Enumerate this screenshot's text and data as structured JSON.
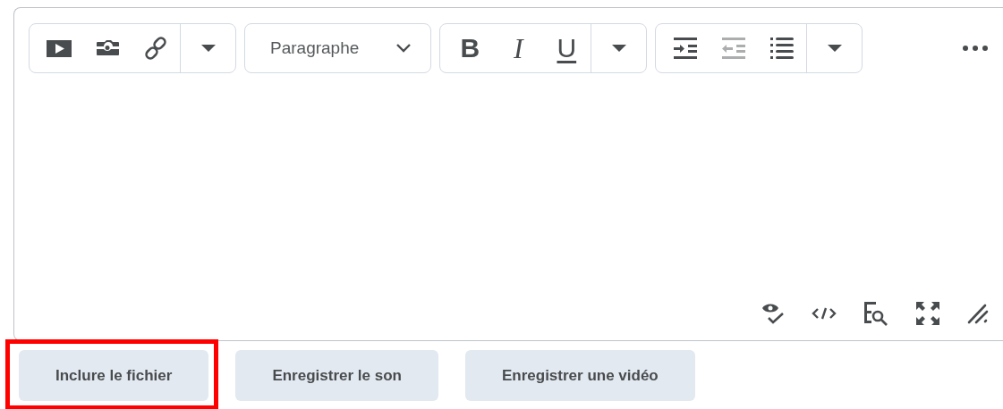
{
  "toolbar": {
    "groups": [
      {
        "kind": "buttons",
        "items": [
          {
            "kind": "video",
            "disabled": false
          },
          {
            "kind": "camera",
            "disabled": false
          },
          {
            "kind": "link",
            "disabled": false
          },
          {
            "kind": "menu",
            "disabled": false
          }
        ]
      },
      {
        "kind": "select",
        "label": "Paragraphe"
      },
      {
        "kind": "buttons",
        "items": [
          {
            "kind": "bold",
            "text": "B",
            "disabled": false
          },
          {
            "kind": "italic",
            "text": "I",
            "disabled": false
          },
          {
            "kind": "underline",
            "text": "U",
            "disabled": false
          },
          {
            "kind": "menu",
            "disabled": false
          }
        ]
      },
      {
        "kind": "buttons",
        "items": [
          {
            "kind": "indent",
            "disabled": false
          },
          {
            "kind": "outdent",
            "disabled": true
          },
          {
            "kind": "list",
            "disabled": false
          },
          {
            "kind": "menu",
            "disabled": false
          }
        ]
      }
    ],
    "more": {
      "kind": "dots"
    }
  },
  "editor": {
    "footer_icons": [
      {
        "kind": "preview"
      },
      {
        "kind": "code"
      },
      {
        "kind": "find"
      },
      {
        "kind": "fullscreen"
      },
      {
        "kind": "resize"
      }
    ]
  },
  "buttons": [
    {
      "label": "Inclure le fichier",
      "highlighted": true
    },
    {
      "label": "Enregistrer le son",
      "highlighted": false
    },
    {
      "label": "Enregistrer une vidéo",
      "highlighted": false
    }
  ]
}
